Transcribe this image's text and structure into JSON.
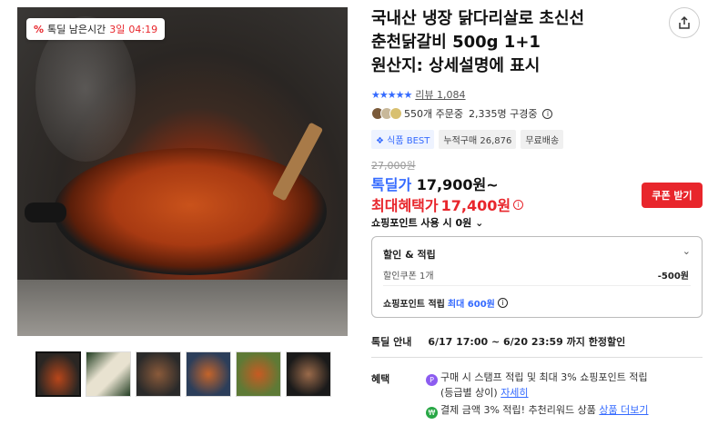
{
  "timer": {
    "label": "톡딜 남은시간",
    "days": "3일",
    "time": "04:19"
  },
  "product": {
    "title_lines": [
      "국내산 냉장 닭다리살로 초신선",
      "춘천닭갈비 500g 1+1",
      "원산지: 상세설명에 표시"
    ]
  },
  "rating": {
    "stars": "★★★★★",
    "review_label": "리뷰 1,084"
  },
  "social": {
    "orders": "550개 주문중",
    "subscribers": "2,335명 구경중"
  },
  "tags": [
    "식품 BEST",
    "누적구매 26,876",
    "무료배송"
  ],
  "price": {
    "original": "27,000원",
    "deal_label": "톡딜가",
    "deal_value": "17,900원~",
    "max_label": "최대혜택가",
    "max_value": "17,400원",
    "coupon_button": "쿠폰 받기",
    "point_use": "쇼핑포인트 사용 시 0원"
  },
  "discount": {
    "header": "할인 & 적립",
    "coupon_label": "할인쿠폰 1개",
    "coupon_value": "-500원",
    "point_label": "쇼핑포인트 적립",
    "point_value": "최대 600원"
  },
  "deal_info": {
    "label": "톡딜 안내",
    "period": "6/17 17:00 ~ 6/20 23:59 까지 한정할인"
  },
  "benefits": {
    "label": "혜택",
    "b1_line1": "구매 시 스탬프 적립 및 최대 3% 쇼핑포인트 적립",
    "b1_line2": "(등급별 상이)",
    "b1_link": "자세히",
    "b2_text": "결제 금액 3% 적립! 추천리워드 상품",
    "b2_link": "상품 더보기"
  },
  "colors": {
    "accent_blue": "#346aff",
    "accent_red": "#e8262c"
  }
}
